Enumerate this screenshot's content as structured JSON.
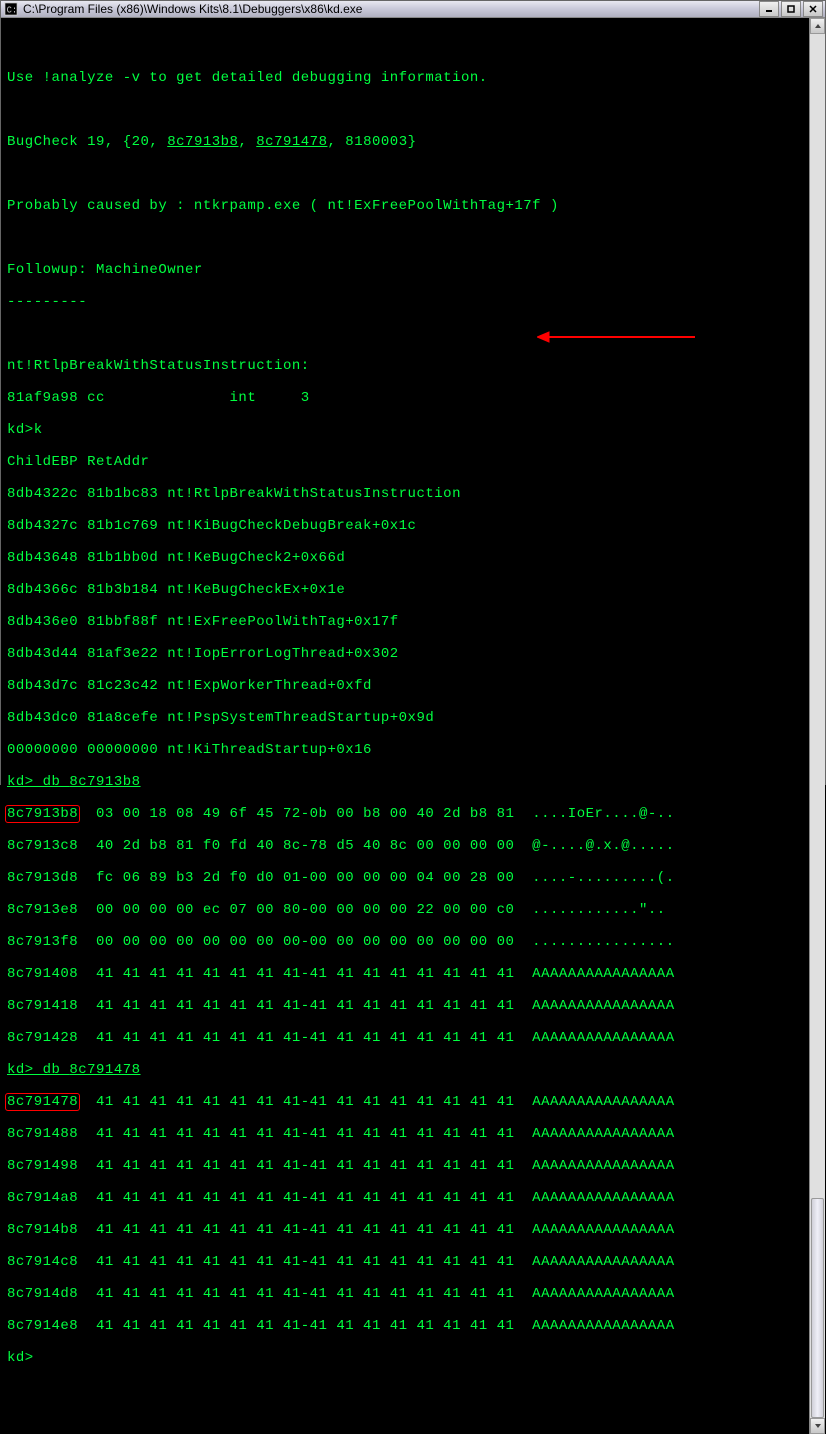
{
  "titlebar": {
    "path": "C:\\Program Files (x86)\\Windows Kits\\8.1\\Debuggers\\x86\\kd.exe"
  },
  "term": {
    "l1": "Use !analyze -v to get detailed debugging information.",
    "l2a": "BugCheck 19, {20, ",
    "l2b": "8c7913b8",
    "l2c": ", ",
    "l2d": "8c791478",
    "l2e": ", 8180003}",
    "l3": "Probably caused by : ntkrpamp.exe ( nt!ExFreePoolWithTag+17f )",
    "l4": "Followup: MachineOwner",
    "l5": "---------",
    "l6": "nt!RtlpBreakWithStatusInstruction:",
    "l7": "81af9a98 cc              int     3",
    "l8": "kd>k",
    "l9": "ChildEBP RetAddr",
    "k1": "8db4322c 81b1bc83 nt!RtlpBreakWithStatusInstruction",
    "k2": "8db4327c 81b1c769 nt!KiBugCheckDebugBreak+0x1c",
    "k3": "8db43648 81b1bb0d nt!KeBugCheck2+0x66d",
    "k4": "8db4366c 81b3b184 nt!KeBugCheckEx+0x1e",
    "k5": "8db436e0 81bbf88f nt!ExFreePoolWithTag+0x17f",
    "k6": "8db43d44 81af3e22 nt!IopErrorLogThread+0x302",
    "k7": "8db43d7c 81c23c42 nt!ExpWorkerThread+0xfd",
    "k8": "8db43dc0 81a8cefe nt!PspSystemThreadStartup+0x9d",
    "k9": "00000000 00000000 nt!KiThreadStartup+0x16",
    "cmd1a": "kd> db ",
    "cmd1b": "8c7913b8",
    "d1addr": "8c7913b8",
    "d1rest": "  03 00 18 08 49 6f 45 72-0b 00 b8 00 40 2d b8 81  ....IoEr....@-..",
    "d2": "8c7913c8  40 2d b8 81 f0 fd 40 8c-78 d5 40 8c 00 00 00 00  @-....@.x.@.....",
    "d3": "8c7913d8  fc 06 89 b3 2d f0 d0 01-00 00 00 00 04 00 28 00  ....-.........(.",
    "d4": "8c7913e8  00 00 00 00 ec 07 00 80-00 00 00 00 22 00 00 c0  ............\"..",
    "d5": "8c7913f8  00 00 00 00 00 00 00 00-00 00 00 00 00 00 00 00  ................",
    "d6": "8c791408  41 41 41 41 41 41 41 41-41 41 41 41 41 41 41 41  AAAAAAAAAAAAAAAA",
    "d7": "8c791418  41 41 41 41 41 41 41 41-41 41 41 41 41 41 41 41  AAAAAAAAAAAAAAAA",
    "d8": "8c791428  41 41 41 41 41 41 41 41-41 41 41 41 41 41 41 41  AAAAAAAAAAAAAAAA",
    "cmd2a": "kd> db ",
    "cmd2b": "8c791478",
    "e1addr": "8c791478",
    "e1rest": "  41 41 41 41 41 41 41 41-41 41 41 41 41 41 41 41  AAAAAAAAAAAAAAAA",
    "e2": "8c791488  41 41 41 41 41 41 41 41-41 41 41 41 41 41 41 41  AAAAAAAAAAAAAAAA",
    "e3": "8c791498  41 41 41 41 41 41 41 41-41 41 41 41 41 41 41 41  AAAAAAAAAAAAAAAA",
    "e4": "8c7914a8  41 41 41 41 41 41 41 41-41 41 41 41 41 41 41 41  AAAAAAAAAAAAAAAA",
    "e5": "8c7914b8  41 41 41 41 41 41 41 41-41 41 41 41 41 41 41 41  AAAAAAAAAAAAAAAA",
    "e6": "8c7914c8  41 41 41 41 41 41 41 41-41 41 41 41 41 41 41 41  AAAAAAAAAAAAAAAA",
    "e7": "8c7914d8  41 41 41 41 41 41 41 41-41 41 41 41 41 41 41 41  AAAAAAAAAAAAAAAA",
    "e8": "8c7914e8  41 41 41 41 41 41 41 41-41 41 41 41 41 41 41 41  AAAAAAAAAAAAAAAA",
    "prompt": "kd>"
  }
}
